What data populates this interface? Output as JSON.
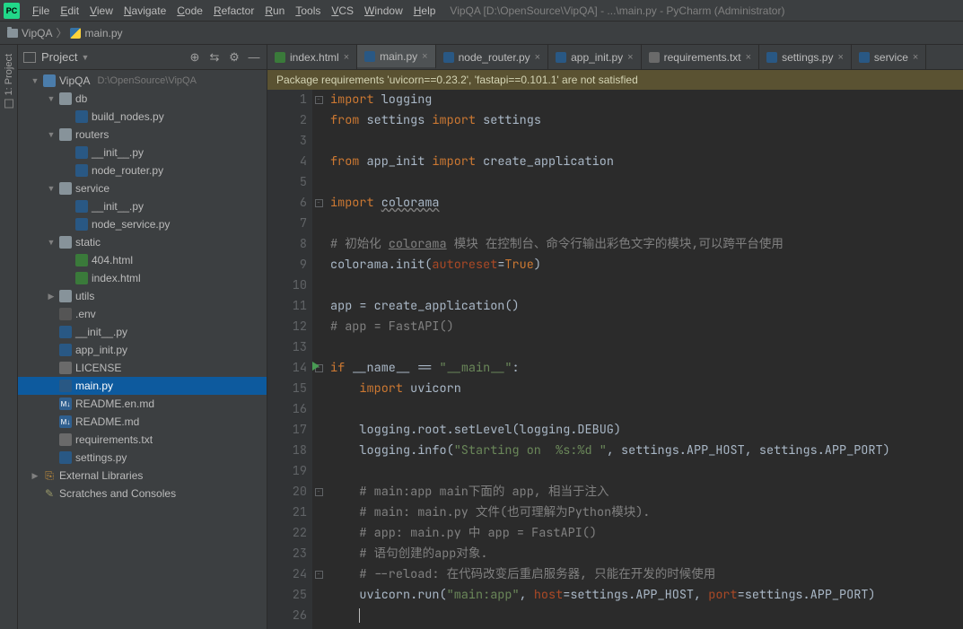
{
  "window": {
    "title_path": "VipQA [D:\\OpenSource\\VipQA] - ...\\main.py - PyCharm (Administrator)"
  },
  "menu": [
    "File",
    "Edit",
    "View",
    "Navigate",
    "Code",
    "Refactor",
    "Run",
    "Tools",
    "VCS",
    "Window",
    "Help"
  ],
  "breadcrumb": [
    {
      "icon": "folder",
      "label": "VipQA"
    },
    {
      "icon": "py",
      "label": "main.py"
    }
  ],
  "toolstripe": {
    "project_label": "1: Project"
  },
  "project_panel": {
    "title": "Project",
    "tools": [
      "target",
      "autoscroll",
      "gear",
      "hide"
    ],
    "tree": [
      {
        "d": 0,
        "exp": "▼",
        "icon": "mod",
        "label": "VipQA",
        "meta": "D:\\OpenSource\\VipQA"
      },
      {
        "d": 1,
        "exp": "▼",
        "icon": "folder",
        "label": "db"
      },
      {
        "d": 2,
        "exp": "",
        "icon": "py",
        "label": "build_nodes.py"
      },
      {
        "d": 1,
        "exp": "▼",
        "icon": "folder",
        "label": "routers"
      },
      {
        "d": 2,
        "exp": "",
        "icon": "py",
        "label": "__init__.py"
      },
      {
        "d": 2,
        "exp": "",
        "icon": "py",
        "label": "node_router.py"
      },
      {
        "d": 1,
        "exp": "▼",
        "icon": "folder",
        "label": "service"
      },
      {
        "d": 2,
        "exp": "",
        "icon": "py",
        "label": "__init__.py"
      },
      {
        "d": 2,
        "exp": "",
        "icon": "py",
        "label": "node_service.py"
      },
      {
        "d": 1,
        "exp": "▼",
        "icon": "folder",
        "label": "static"
      },
      {
        "d": 2,
        "exp": "",
        "icon": "html",
        "label": "404.html"
      },
      {
        "d": 2,
        "exp": "",
        "icon": "html",
        "label": "index.html"
      },
      {
        "d": 1,
        "exp": "▶",
        "icon": "folder",
        "label": "utils"
      },
      {
        "d": 1,
        "exp": "",
        "icon": "env",
        "label": ".env"
      },
      {
        "d": 1,
        "exp": "",
        "icon": "py",
        "label": "__init__.py"
      },
      {
        "d": 1,
        "exp": "",
        "icon": "py",
        "label": "app_init.py"
      },
      {
        "d": 1,
        "exp": "",
        "icon": "txt",
        "label": "LICENSE"
      },
      {
        "d": 1,
        "exp": "",
        "icon": "py",
        "label": "main.py",
        "selected": true
      },
      {
        "d": 1,
        "exp": "",
        "icon": "md",
        "label": "README.en.md"
      },
      {
        "d": 1,
        "exp": "",
        "icon": "md",
        "label": "README.md"
      },
      {
        "d": 1,
        "exp": "",
        "icon": "txt",
        "label": "requirements.txt"
      },
      {
        "d": 1,
        "exp": "",
        "icon": "py",
        "label": "settings.py"
      },
      {
        "d": 0,
        "exp": "▶",
        "icon": "lib",
        "label": "External Libraries"
      },
      {
        "d": 0,
        "exp": "",
        "icon": "scratch",
        "label": "Scratches and Consoles"
      }
    ]
  },
  "tabs": [
    {
      "icon": "html",
      "label": "index.html"
    },
    {
      "icon": "py",
      "label": "main.py",
      "active": true
    },
    {
      "icon": "py",
      "label": "node_router.py"
    },
    {
      "icon": "py",
      "label": "app_init.py"
    },
    {
      "icon": "txt",
      "label": "requirements.txt"
    },
    {
      "icon": "py",
      "label": "settings.py"
    },
    {
      "icon": "py",
      "label": "service"
    }
  ],
  "warning": "Package requirements 'uvicorn==0.23.2', 'fastapi==0.101.1' are not satisfied",
  "code_lines": [
    {
      "n": 1,
      "fold": "−",
      "html": "<span class='kw'>import</span> logging"
    },
    {
      "n": 2,
      "html": "<span class='kw'>from</span> settings <span class='kw'>import</span> settings"
    },
    {
      "n": 3,
      "html": ""
    },
    {
      "n": 4,
      "html": "<span class='kw'>from</span> app_init <span class='kw'>import</span> create_application"
    },
    {
      "n": 5,
      "html": ""
    },
    {
      "n": 6,
      "fold": "−",
      "html": "<span class='kw'>import</span> <span class='underwave'>colorama</span>"
    },
    {
      "n": 7,
      "html": ""
    },
    {
      "n": 8,
      "html": "<span class='com'># 初始化 <u>colorama</u> 模块 在控制台、命令行输出彩色文字的模块,可以跨平台使用</span>"
    },
    {
      "n": 9,
      "html": "colorama.init(<span class='par'>autoreset</span>=<span class='kw'>True</span>)"
    },
    {
      "n": 10,
      "html": ""
    },
    {
      "n": 11,
      "html": "app = create_application()"
    },
    {
      "n": 12,
      "html": "<span class='com'># app = FastAPI()</span>"
    },
    {
      "n": 13,
      "html": ""
    },
    {
      "n": 14,
      "fold": "−",
      "run": true,
      "html": "<span class='kw'>if</span> __name__ == <span class='str'>\"__main__\"</span>:"
    },
    {
      "n": 15,
      "html": "    <span class='kw'>import</span> uvicorn"
    },
    {
      "n": 16,
      "html": ""
    },
    {
      "n": 17,
      "html": "    logging.root.setLevel(logging.DEBUG)"
    },
    {
      "n": 18,
      "html": "    logging.info(<span class='str'>\"Starting on  %s:%d \"</span>, settings.APP_HOST, settings.APP_PORT)"
    },
    {
      "n": 19,
      "html": ""
    },
    {
      "n": 20,
      "fold": "−",
      "html": "    <span class='com'># main:app main下面的 app, 相当于注入</span>"
    },
    {
      "n": 21,
      "html": "    <span class='com'># main: main.py 文件(也可理解为Python模块).</span>"
    },
    {
      "n": 22,
      "html": "    <span class='com'># app: main.py 中 app = FastAPI()</span>"
    },
    {
      "n": 23,
      "html": "    <span class='com'># 语句创建的app对象.</span>"
    },
    {
      "n": 24,
      "fold": "−",
      "html": "    <span class='com'># --reload: 在代码改变后重启服务器, 只能在开发的时候使用</span>"
    },
    {
      "n": 25,
      "html": "    uvicorn.run(<span class='str'>\"main:app\"</span>, <span class='par'>host</span>=settings.APP_HOST, <span class='par'>port</span>=settings.APP_PORT)"
    },
    {
      "n": 26,
      "html": "    <span class='caret'></span>"
    }
  ]
}
